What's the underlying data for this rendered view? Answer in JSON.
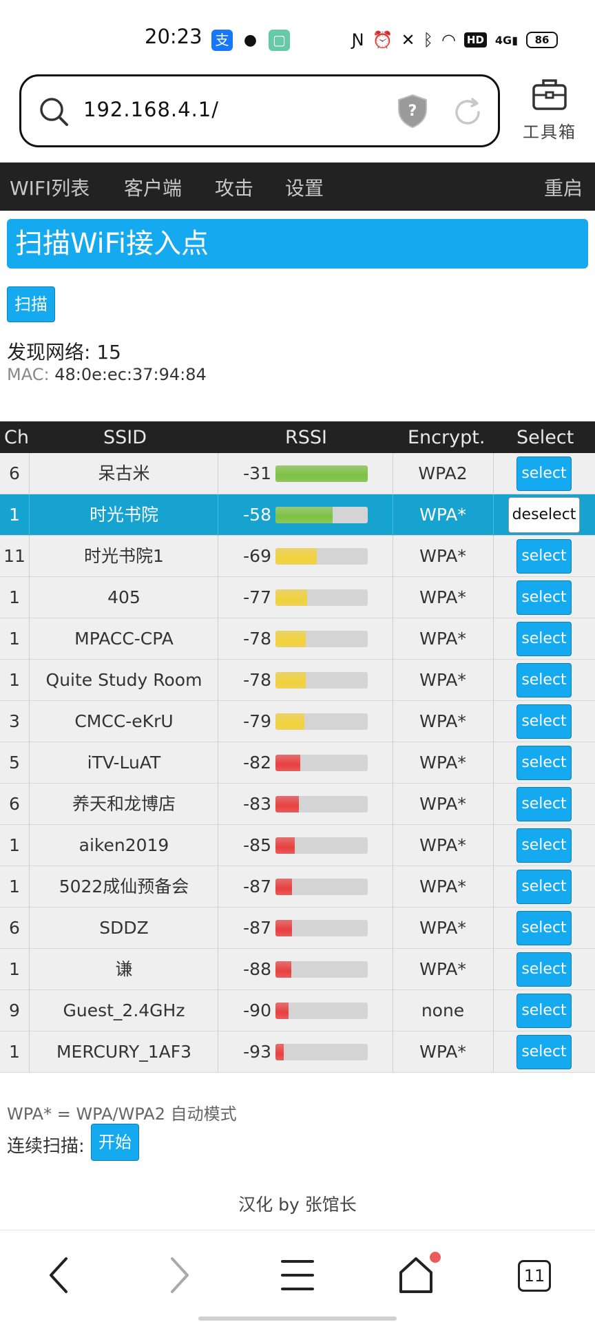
{
  "status_bar": {
    "time": "20:23",
    "app_icons": [
      "alipay-icon",
      "wechat-icon",
      "app-icon"
    ],
    "system_icons": [
      "nfc-icon",
      "alarm-icon",
      "mute-icon",
      "bluetooth-icon",
      "wifi-icon",
      "hd-icon",
      "signal-4g-icon"
    ],
    "hd_label": "HD",
    "network_label": "4G",
    "battery": "86"
  },
  "browser": {
    "url": "192.168.4.1/",
    "toolbox_label": "工具箱"
  },
  "nav": {
    "items": [
      "WIFI列表",
      "客户端",
      "攻击",
      "设置"
    ],
    "restart": "重启"
  },
  "page": {
    "heading": "扫描WiFi接入点",
    "scan_button": "扫描",
    "found_networks": "发现网络: 15",
    "mac_label": "MAC:",
    "mac_value": "48:0e:ec:37:94:84"
  },
  "table": {
    "headers": [
      "Ch",
      "SSID",
      "RSSI",
      "Encrypt.",
      "Select"
    ],
    "rows": [
      {
        "ch": "6",
        "ssid": "呆古米",
        "rssi": "-31",
        "enc": "WPA2",
        "action": "select",
        "selected": false,
        "level": 1.0,
        "color": "#7dc242"
      },
      {
        "ch": "1",
        "ssid": "时光书院",
        "rssi": "-58",
        "enc": "WPA*",
        "action": "deselect",
        "selected": true,
        "level": 0.62,
        "color": "#7dc242"
      },
      {
        "ch": "11",
        "ssid": "时光书院1",
        "rssi": "-69",
        "enc": "WPA*",
        "action": "select",
        "selected": false,
        "level": 0.45,
        "color": "#f2d23a"
      },
      {
        "ch": "1",
        "ssid": "405",
        "rssi": "-77",
        "enc": "WPA*",
        "action": "select",
        "selected": false,
        "level": 0.34,
        "color": "#f2d23a"
      },
      {
        "ch": "1",
        "ssid": "MPACC-CPA",
        "rssi": "-78",
        "enc": "WPA*",
        "action": "select",
        "selected": false,
        "level": 0.33,
        "color": "#f2d23a"
      },
      {
        "ch": "1",
        "ssid": "Quite Study Room",
        "rssi": "-78",
        "enc": "WPA*",
        "action": "select",
        "selected": false,
        "level": 0.33,
        "color": "#f2d23a"
      },
      {
        "ch": "3",
        "ssid": "CMCC-eKrU",
        "rssi": "-79",
        "enc": "WPA*",
        "action": "select",
        "selected": false,
        "level": 0.31,
        "color": "#f2d23a"
      },
      {
        "ch": "5",
        "ssid": "iTV-LuAT",
        "rssi": "-82",
        "enc": "WPA*",
        "action": "select",
        "selected": false,
        "level": 0.27,
        "color": "#e8403f"
      },
      {
        "ch": "6",
        "ssid": "养天和龙博店",
        "rssi": "-83",
        "enc": "WPA*",
        "action": "select",
        "selected": false,
        "level": 0.25,
        "color": "#e8403f"
      },
      {
        "ch": "1",
        "ssid": "aiken2019",
        "rssi": "-85",
        "enc": "WPA*",
        "action": "select",
        "selected": false,
        "level": 0.21,
        "color": "#e8403f"
      },
      {
        "ch": "1",
        "ssid": "5022成仙预备会",
        "rssi": "-87",
        "enc": "WPA*",
        "action": "select",
        "selected": false,
        "level": 0.18,
        "color": "#e8403f"
      },
      {
        "ch": "6",
        "ssid": "SDDZ",
        "rssi": "-87",
        "enc": "WPA*",
        "action": "select",
        "selected": false,
        "level": 0.18,
        "color": "#e8403f"
      },
      {
        "ch": "1",
        "ssid": "谦",
        "rssi": "-88",
        "enc": "WPA*",
        "action": "select",
        "selected": false,
        "level": 0.17,
        "color": "#e8403f"
      },
      {
        "ch": "9",
        "ssid": "Guest_2.4GHz",
        "rssi": "-90",
        "enc": "none",
        "action": "select",
        "selected": false,
        "level": 0.14,
        "color": "#e8403f"
      },
      {
        "ch": "1",
        "ssid": "MERCURY_1AF3",
        "rssi": "-93",
        "enc": "WPA*",
        "action": "select",
        "selected": false,
        "level": 0.09,
        "color": "#e8403f"
      }
    ]
  },
  "footer": {
    "note": "WPA* = WPA/WPA2 自动模式",
    "continuous_label": "连续扫描:",
    "start_button": "开始",
    "credit": "汉化 by 张馆长"
  },
  "bottom_nav": {
    "icons": [
      "back-icon",
      "forward-icon",
      "menu-icon",
      "home-icon",
      "tabs-icon"
    ],
    "tab_count": "11"
  },
  "colors": {
    "accent": "#15aaf0",
    "nav_bg": "#222222",
    "selected_row": "#16a3d0"
  }
}
